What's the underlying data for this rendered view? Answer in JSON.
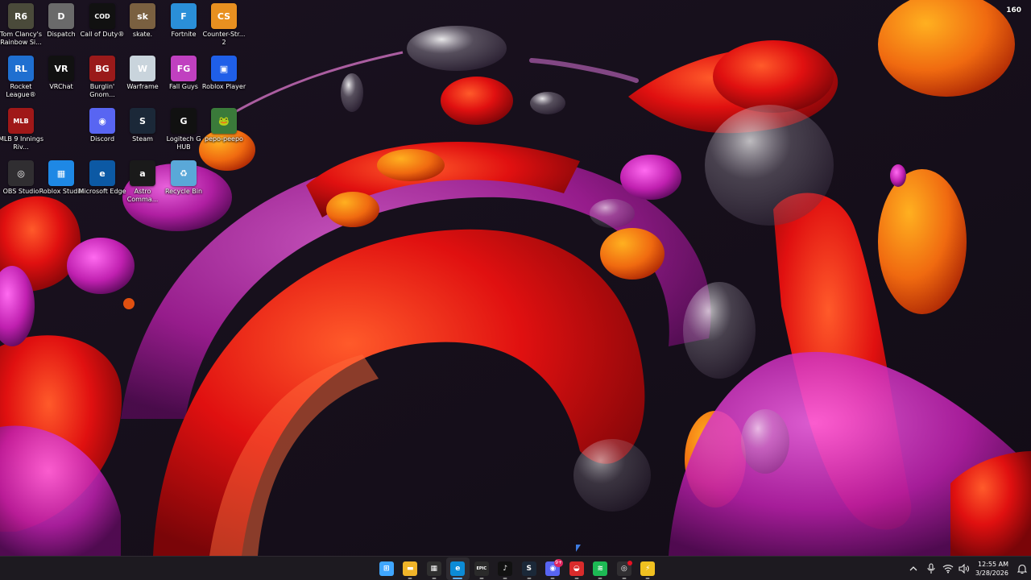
{
  "desktop": {
    "icons": [
      {
        "label": "Tom Clancy's Rainbow Si...",
        "icon": "rainbow-six-icon",
        "color": "#4a4a3a",
        "glyph": "R6"
      },
      {
        "label": "Dispatch",
        "icon": "dispatch-icon",
        "color": "#6a6a6a",
        "glyph": "D"
      },
      {
        "label": "Call of Duty®",
        "icon": "call-of-duty-icon",
        "color": "#111111",
        "glyph": "COD"
      },
      {
        "label": "skate.",
        "icon": "skate-icon",
        "color": "#7a6040",
        "glyph": "sk"
      },
      {
        "label": "Fortnite",
        "icon": "fortnite-icon",
        "color": "#2a8fd8",
        "glyph": "F"
      },
      {
        "label": "Counter-Str... 2",
        "icon": "counter-strike-icon",
        "color": "#e89020",
        "glyph": "CS"
      },
      {
        "label": "Rocket League®",
        "icon": "rocket-league-icon",
        "color": "#1f6fd0",
        "glyph": "RL"
      },
      {
        "label": "VRChat",
        "icon": "vrchat-icon",
        "color": "#111111",
        "glyph": "VR"
      },
      {
        "label": "Burglin' Gnom...",
        "icon": "burglin-gnomes-icon",
        "color": "#9a1a1a",
        "glyph": "BG"
      },
      {
        "label": "Warframe",
        "icon": "warframe-icon",
        "color": "#c9d4dc",
        "glyph": "W"
      },
      {
        "label": "Fall Guys",
        "icon": "fall-guys-icon",
        "color": "#c040c0",
        "glyph": "FG"
      },
      {
        "label": "Roblox Player",
        "icon": "roblox-player-icon",
        "color": "#1f5fe8",
        "glyph": "▣"
      },
      {
        "label": "MLB 9 Innings Riv...",
        "icon": "mlb-innings-icon",
        "color": "#a01818",
        "glyph": "MLB"
      },
      {
        "label": "Discord",
        "icon": "discord-icon",
        "color": "#5865f2",
        "glyph": "◉"
      },
      {
        "label": "Steam",
        "icon": "steam-icon",
        "color": "#1b2838",
        "glyph": "S"
      },
      {
        "label": "Logitech G HUB",
        "icon": "logitech-ghub-icon",
        "color": "#111111",
        "glyph": "G"
      },
      {
        "label": "pepo-peepo",
        "icon": "pepo-peepo-icon",
        "color": "#3a7a3a",
        "glyph": "🐸"
      },
      {
        "label": "OBS Studio",
        "icon": "obs-studio-icon",
        "color": "#302e31",
        "glyph": "◎"
      },
      {
        "label": "Roblox Studio",
        "icon": "roblox-studio-icon",
        "color": "#1e88e5",
        "glyph": "▦"
      },
      {
        "label": "Microsoft Edge",
        "icon": "edge-icon",
        "color": "#0c59a4",
        "glyph": "e"
      },
      {
        "label": "Astro Comma...",
        "icon": "astro-command-icon",
        "color": "#1a1a1a",
        "glyph": "a"
      },
      {
        "label": "Recycle Bin",
        "icon": "recycle-bin-icon",
        "color": "#5aa8d8",
        "glyph": "♻"
      }
    ]
  },
  "overlay": {
    "fps": "160"
  },
  "taskbar": {
    "apps": [
      {
        "name": "start",
        "icon": "windows-start-icon",
        "color": "#3fa6ff",
        "glyph": "⊞"
      },
      {
        "name": "file-explorer",
        "icon": "folder-icon",
        "color": "#f0b429",
        "glyph": "▬"
      },
      {
        "name": "store",
        "icon": "store-icon",
        "color": "#2f2f2f",
        "glyph": "▦"
      },
      {
        "name": "edge",
        "icon": "edge-icon",
        "color": "#0c8bd6",
        "glyph": "e"
      },
      {
        "name": "epic-games",
        "icon": "epic-games-icon",
        "color": "#2a2a2a",
        "glyph": "EPIC"
      },
      {
        "name": "tiktok",
        "icon": "tiktok-icon",
        "color": "#111111",
        "glyph": "♪"
      },
      {
        "name": "steam",
        "icon": "steam-icon",
        "color": "#1b2838",
        "glyph": "S"
      },
      {
        "name": "discord",
        "icon": "discord-icon",
        "color": "#5865f2",
        "glyph": "◉",
        "badge": "9+"
      },
      {
        "name": "app-red",
        "icon": "red-app-icon",
        "color": "#d92b2b",
        "glyph": "◒"
      },
      {
        "name": "spotify",
        "icon": "spotify-icon",
        "color": "#1db954",
        "glyph": "≋"
      },
      {
        "name": "obs",
        "icon": "obs-studio-icon",
        "color": "#302e31",
        "glyph": "◎"
      },
      {
        "name": "app-yellow",
        "icon": "yellow-app-icon",
        "color": "#f0c020",
        "glyph": "⚡"
      }
    ],
    "tray": {
      "clock_time": "12:55 AM",
      "clock_date": "3/28/2026"
    }
  }
}
